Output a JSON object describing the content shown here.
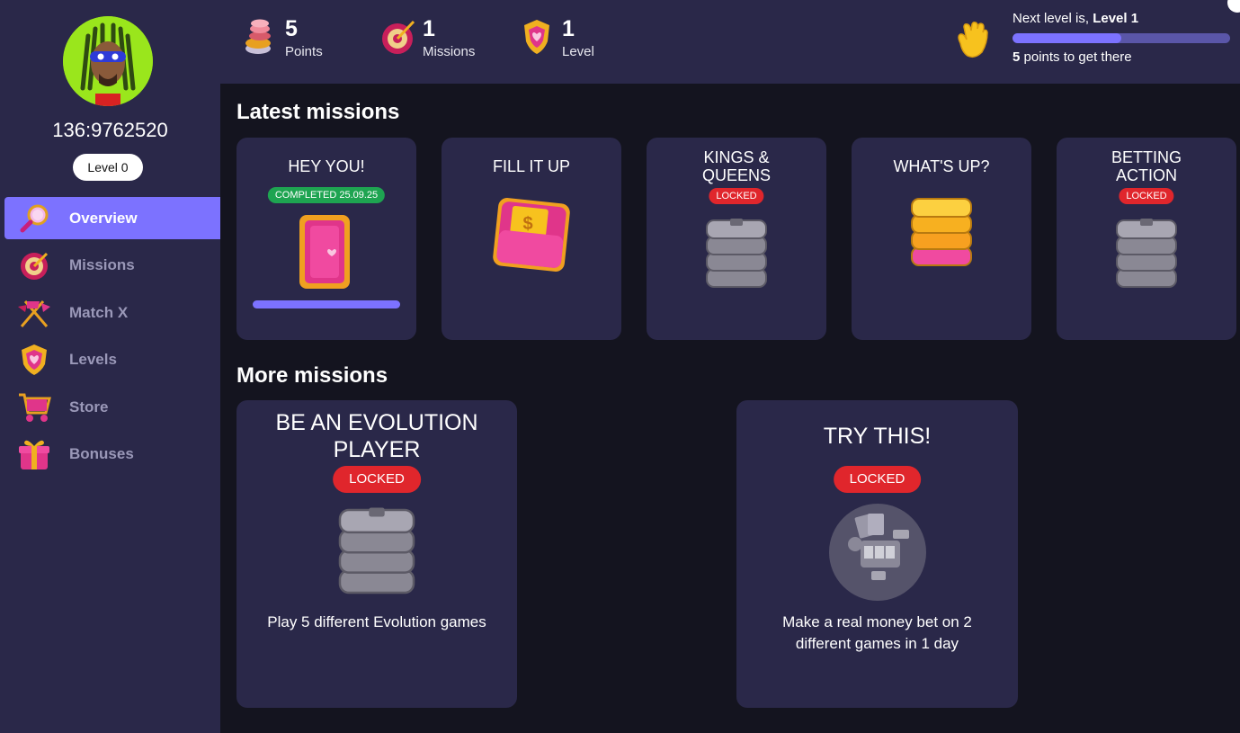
{
  "user": {
    "name": "136:9762520",
    "level_label": "Level 0"
  },
  "nav": [
    {
      "label": "Overview",
      "icon": "magnifier-icon"
    },
    {
      "label": "Missions",
      "icon": "target-icon"
    },
    {
      "label": "Match X",
      "icon": "crossed-flags-icon"
    },
    {
      "label": "Levels",
      "icon": "shield-icon"
    },
    {
      "label": "Store",
      "icon": "cart-icon"
    },
    {
      "label": "Bonuses",
      "icon": "gift-icon"
    }
  ],
  "stats": {
    "points": {
      "value": "5",
      "label": "Points"
    },
    "missions": {
      "value": "1",
      "label": "Missions"
    },
    "level": {
      "value": "1",
      "label": "Level"
    }
  },
  "next_level": {
    "prefix": "Next level is, ",
    "level": "Level 1",
    "points": "5",
    "suffix": " points to get there",
    "progress_fraction": 0.5
  },
  "sections": {
    "latest": "Latest missions",
    "more": "More missions"
  },
  "latest_missions": [
    {
      "title": "HEY YOU!",
      "badge": "COMPLETED 25.09.25",
      "status": "completed"
    },
    {
      "title": "FILL IT UP",
      "badge": "",
      "status": "open"
    },
    {
      "title": "KINGS & QUEENS",
      "badge": "LOCKED",
      "status": "locked"
    },
    {
      "title": "WHAT'S UP?",
      "badge": "",
      "status": "open"
    },
    {
      "title": "BETTING ACTION",
      "badge": "LOCKED",
      "status": "locked"
    }
  ],
  "more_missions": [
    {
      "title": "BE AN EVOLUTION PLAYER",
      "badge": "LOCKED",
      "desc": "Play 5 different Evolution games"
    },
    {
      "title": "TRY THIS!",
      "badge": "LOCKED",
      "desc": "Make a real money bet on 2 different games in 1 day"
    }
  ],
  "colors": {
    "accent": "#7c72ff",
    "panel": "#2a2849",
    "background": "#14141f",
    "locked": "#e0262c",
    "completed": "#1ea451"
  }
}
